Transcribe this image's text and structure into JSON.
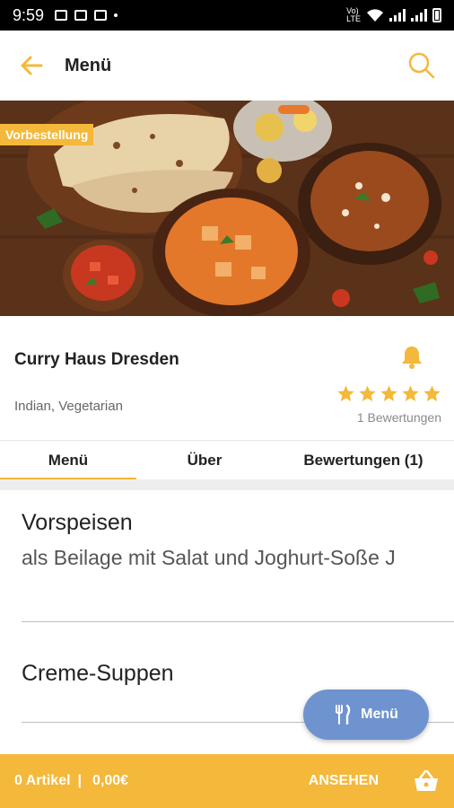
{
  "status_bar": {
    "time": "9:59",
    "network_label": "Vo)\nLTE"
  },
  "app_bar": {
    "title": "Menü",
    "back_icon": "arrow-left-icon",
    "search_icon": "search-icon"
  },
  "hero": {
    "badge": "Vorbestellung"
  },
  "restaurant": {
    "name": "Curry Haus Dresden",
    "cuisine": "Indian, Vegetarian",
    "rating": 5,
    "reviews_text": "1 Bewertungen"
  },
  "tabs": [
    {
      "label": "Menü",
      "active": true
    },
    {
      "label": "Über",
      "active": false
    },
    {
      "label": "Bewertungen (1)",
      "active": false
    }
  ],
  "sections": [
    {
      "title": "Vorspeisen",
      "description": "als Beilage mit Salat und Joghurt-Soße J"
    },
    {
      "title": "Creme-Suppen",
      "description": ""
    }
  ],
  "fab": {
    "label": "Menü",
    "icon": "cutlery-icon"
  },
  "cart_bar": {
    "count": "0 Artikel",
    "separator": "|",
    "total": "0,00€",
    "view_label": "ANSEHEN",
    "icon": "basket-icon"
  },
  "colors": {
    "accent": "#f4b83a",
    "fab": "#6f93cf",
    "statusbar": "#000000"
  }
}
